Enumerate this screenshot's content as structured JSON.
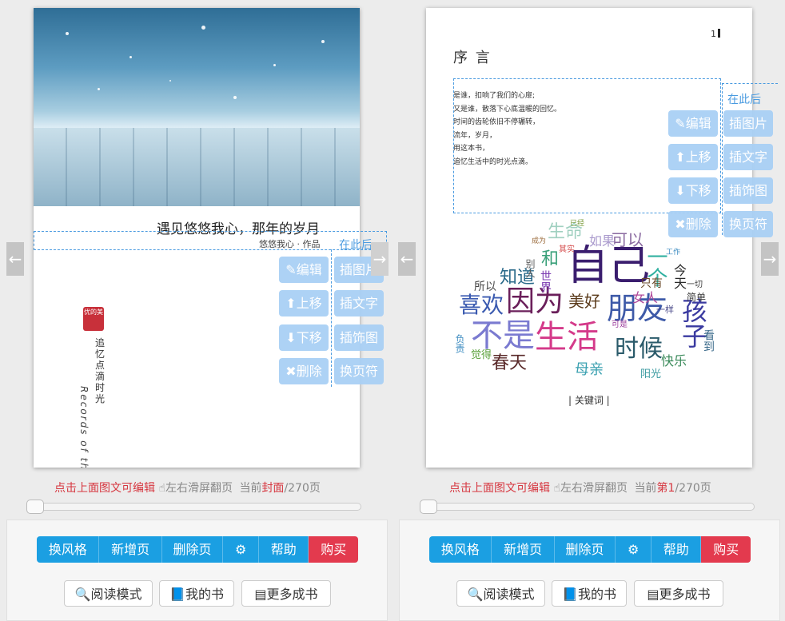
{
  "left": {
    "cover_title": "遇见悠悠我心，那年的岁月",
    "cover_author": "悠悠我心 · 作品",
    "seal": "优的美",
    "vertical_cn": "追忆点滴时光",
    "vertical_en": "Records of the past",
    "insert_here": "在此后",
    "tools_left": [
      "编辑",
      "上移",
      "下移",
      "删除"
    ],
    "tools_right": [
      "插图片",
      "插文字",
      "插饰图",
      "换页符"
    ],
    "hint_edit": "点击上面图文可编辑",
    "hint_swipe": "左右滑屏翻页",
    "hint_current": "当前",
    "hint_page": "封面",
    "hint_total": "/270页"
  },
  "right": {
    "page_number": "1",
    "title": "序 言",
    "poem": [
      "是谁，扣响了我们的心扉;",
      "又是谁，散落下心底温暖的回忆。",
      "时间的齿轮依旧不停辗转，",
      "流年，岁月，",
      "用这本书，",
      "追忆生活中的时光点滴。"
    ],
    "insert_here": "在此后",
    "tools_left": [
      "编辑",
      "上移",
      "下移",
      "删除"
    ],
    "tools_right": [
      "插图片",
      "插文字",
      "插饰图",
      "换页符"
    ],
    "keywords_label": "| 关键词 |",
    "hint_edit": "点击上面图文可编辑",
    "hint_swipe": "左右滑屏翻页",
    "hint_current": "当前",
    "hint_page": "第1",
    "hint_total": "/270页"
  },
  "wordcloud": [
    {
      "t": "自己",
      "c": "#3a1d6e"
    },
    {
      "t": "因为",
      "c": "#6a1f5a"
    },
    {
      "t": "朋友",
      "c": "#3e5aa8"
    },
    {
      "t": "不是",
      "c": "#7a7ad0"
    },
    {
      "t": "生活",
      "c": "#d43a8a"
    },
    {
      "t": "孩子",
      "c": "#3a3aa0"
    },
    {
      "t": "时候",
      "c": "#2a5a6a"
    },
    {
      "t": "喜欢",
      "c": "#3a5ab0"
    },
    {
      "t": "春天",
      "c": "#5a2a2a"
    },
    {
      "t": "知道",
      "c": "#2a6a8a"
    },
    {
      "t": "美好",
      "c": "#5a3a1a"
    },
    {
      "t": "生命",
      "c": "#a0d0c0"
    },
    {
      "t": "可以",
      "c": "#8a6aa0"
    },
    {
      "t": "一个",
      "c": "#30b0a0"
    },
    {
      "t": "如果",
      "c": "#aa9acd"
    },
    {
      "t": "母亲",
      "c": "#3aa0b0"
    },
    {
      "t": "快乐",
      "c": "#3a8a5a"
    },
    {
      "t": "今天",
      "c": "#2a2a2a"
    },
    {
      "t": "女人",
      "c": "#b04a9a"
    },
    {
      "t": "和",
      "c": "#3aa07a"
    },
    {
      "t": "所以",
      "c": "#4a4a4a"
    },
    {
      "t": "只有",
      "c": "#6a4a2a"
    },
    {
      "t": "简单",
      "c": "#3a3a3a"
    },
    {
      "t": "看到",
      "c": "#3a6a8a"
    },
    {
      "t": "阳光",
      "c": "#3a9aa0"
    },
    {
      "t": "世界",
      "c": "#7a3ab0"
    },
    {
      "t": "觉得",
      "c": "#5aa03a"
    },
    {
      "t": "负责",
      "c": "#3a8ac0"
    },
    {
      "t": "一样",
      "c": "#4a4a8a"
    },
    {
      "t": "别人",
      "c": "#5a5a5a"
    },
    {
      "t": "其实",
      "c": "#d44a4a"
    },
    {
      "t": "一切",
      "c": "#3a3a3a"
    },
    {
      "t": "已经",
      "c": "#7a9a3a"
    },
    {
      "t": "成为",
      "c": "#9a6a3a"
    },
    {
      "t": "工作",
      "c": "#3a8ac0"
    },
    {
      "t": "可是",
      "c": "#9a3a9a"
    }
  ],
  "toolbar": {
    "style": "换风格",
    "add_page": "新增页",
    "delete_page": "删除页",
    "help": "帮助",
    "buy": "购买",
    "read_mode": "阅读模式",
    "my_books": "我的书",
    "more_books": "更多成书"
  },
  "colors": {
    "accent": "#1b9fe2",
    "buy": "#e33a4e",
    "tool": "#a9d0f5",
    "hint_red": "#d6363f"
  }
}
